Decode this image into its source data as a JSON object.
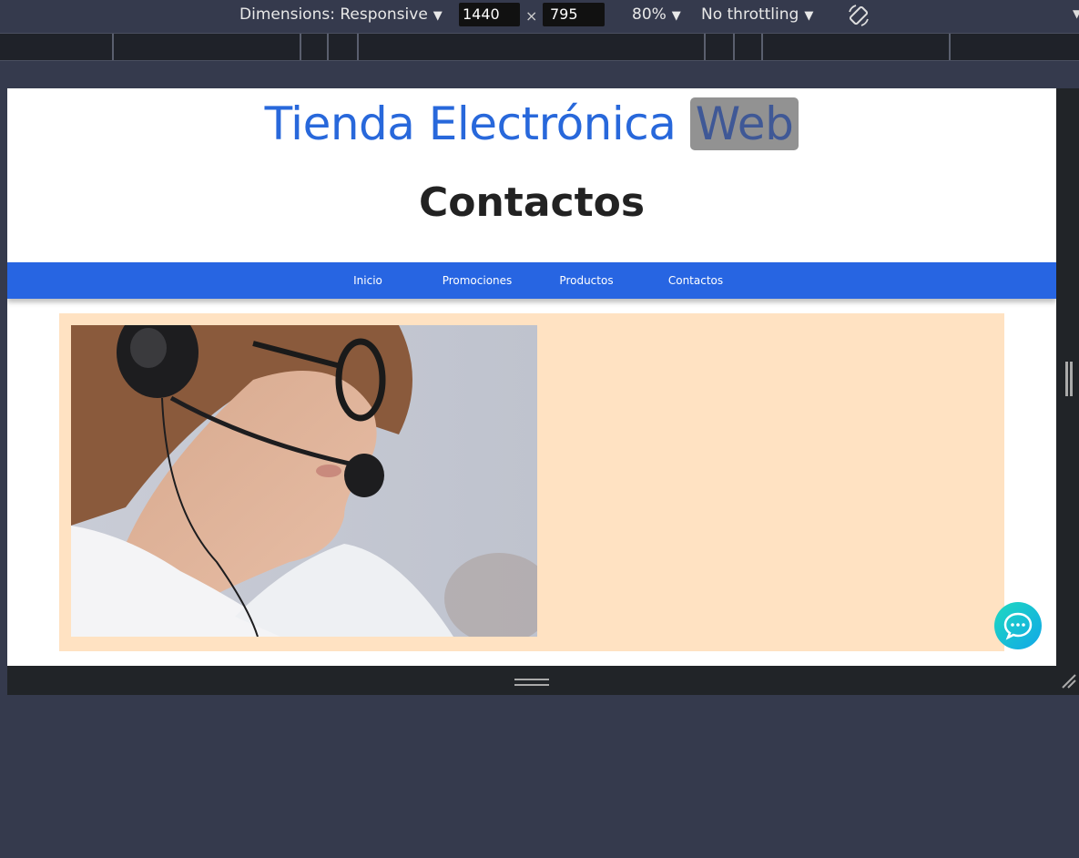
{
  "devtools": {
    "dimensions_label": "Dimensions: Responsive",
    "width_value": "1440",
    "times_sign": "×",
    "height_value": "795",
    "zoom_label": "80%",
    "throttling_label": "No throttling",
    "rotate_icon": "rotate-icon"
  },
  "site": {
    "title_main": "Tienda Electrónica",
    "title_highlight": "Web",
    "page_heading": "Contactos",
    "title_color": "#2868db",
    "nav_color": "#2765e2",
    "panel_color": "#ffe2c2"
  },
  "nav": {
    "items": [
      {
        "label": "Inicio"
      },
      {
        "label": "Promociones"
      },
      {
        "label": "Productos"
      },
      {
        "label": "Contactos"
      }
    ]
  },
  "content": {
    "image": "customer-service-agent-photo",
    "chat_icon": "chat-bubble-icon"
  }
}
